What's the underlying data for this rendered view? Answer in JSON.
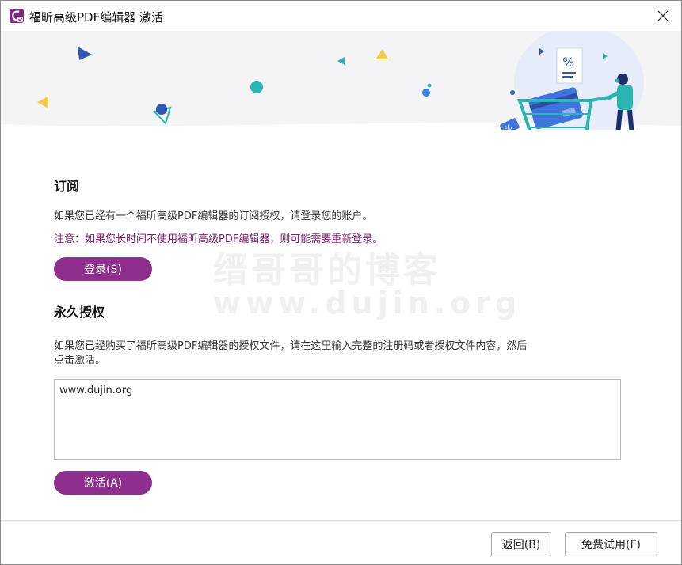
{
  "window": {
    "title": "福昕高级PDF编辑器 激活",
    "close_label": "✕"
  },
  "subscription": {
    "heading": "订阅",
    "description": "如果您已经有一个福昕高级PDF编辑器的订阅授权，请登录您的账户。",
    "note": "注意：如果您长时间不使用福昕高级PDF编辑器，则可能需要重新登录。",
    "login_button": "登录(S)"
  },
  "perpetual": {
    "heading": "永久授权",
    "description_line1": "如果您已经购买了福昕高级PDF编辑器的授权文件，请在这里输入完整的注册码或者授权文件内容，然后",
    "description_line2": "点击激活。",
    "license_value": "www.dujin.org",
    "activate_button": "激活(A)"
  },
  "footer": {
    "back_button": "返回(B)",
    "trial_button": "免费试用(F)"
  },
  "watermark": {
    "line1": "缙哥哥的博客",
    "line2": "www.dujin.org"
  },
  "colors": {
    "accent": "#8e2f8e",
    "note": "#7a1f6d",
    "banner_bg": "#f4f4f6"
  }
}
